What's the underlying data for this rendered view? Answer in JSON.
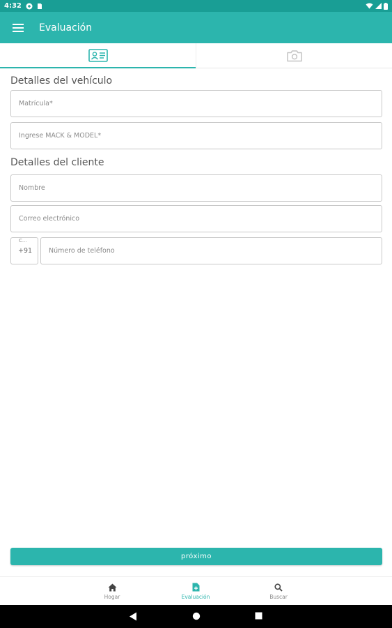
{
  "status_bar": {
    "time": "4:32"
  },
  "app_bar": {
    "title": "Evaluación"
  },
  "tabs": [
    {
      "icon": "id-card-icon",
      "active": true
    },
    {
      "icon": "camera-icon",
      "active": false
    }
  ],
  "vehicle_section": {
    "title": "Detalles del vehículo",
    "plate_placeholder": "Matrícula*",
    "make_model_placeholder": "Ingrese MACK & MODEL*"
  },
  "client_section": {
    "title": "Detalles del cliente",
    "name_placeholder": "Nombre",
    "email_placeholder": "Correo electrónico",
    "country_code_label": "C...",
    "country_code": "+91",
    "phone_placeholder": "Número de teléfono"
  },
  "next_button": {
    "label": "próximo"
  },
  "bottom_nav": [
    {
      "label": "Hogar",
      "icon": "home-icon",
      "active": false
    },
    {
      "label": "Evaluación",
      "icon": "document-add-icon",
      "active": true
    },
    {
      "label": "Buscar",
      "icon": "search-icon",
      "active": false
    }
  ],
  "colors": {
    "accent": "#2cb5ad",
    "status_bar": "#199e95"
  }
}
